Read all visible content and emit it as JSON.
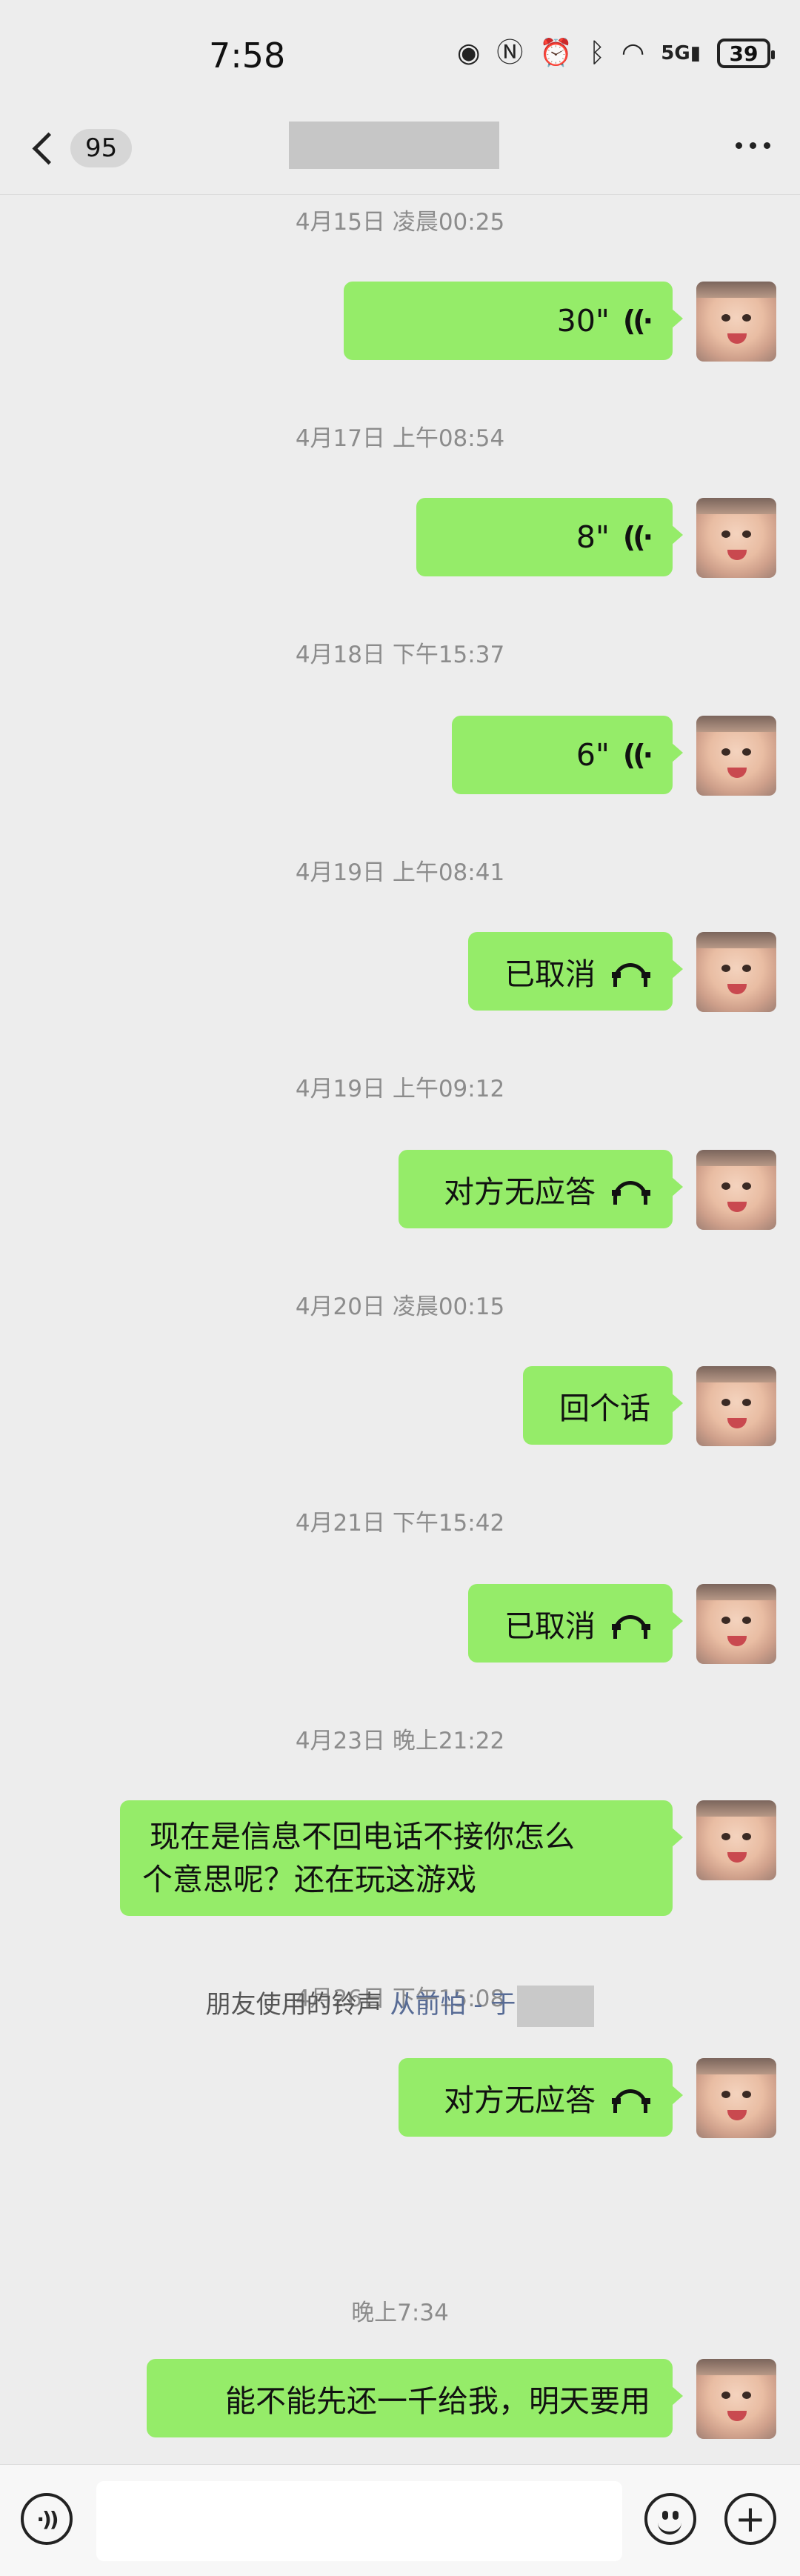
{
  "status_bar": {
    "time": "7:58",
    "icons": [
      "eye-icon",
      "nfc-icon",
      "alarm-icon",
      "bluetooth-icon",
      "wifi-icon",
      "signal-5g-icon"
    ],
    "network": "5G",
    "battery": "39"
  },
  "nav": {
    "unread_count": "95",
    "title": ""
  },
  "messages": [
    {
      "timestamp": "4月15日 凌晨00:25",
      "type": "voice",
      "text": "30\""
    },
    {
      "timestamp": "4月17日 上午08:54",
      "type": "voice",
      "text": "8\""
    },
    {
      "timestamp": "4月18日 下午15:37",
      "type": "voice",
      "text": "6\""
    },
    {
      "timestamp": "4月19日 上午08:41",
      "type": "call",
      "text": "已取消"
    },
    {
      "timestamp": "4月19日 上午09:12",
      "type": "call",
      "text": "对方无应答"
    },
    {
      "timestamp": "4月20日 凌晨00:15",
      "type": "text",
      "text": "回个话"
    },
    {
      "timestamp": "4月21日 下午15:42",
      "type": "call",
      "text": "已取消"
    },
    {
      "timestamp": "4月23日 晚上21:22",
      "type": "text",
      "lines": [
        "现在是信息不回电话不接你怎么",
        "个意思呢？还在玩这游戏"
      ]
    },
    {
      "timestamp": "4月26日 下午15:08",
      "type": "call",
      "text": "对方无应答"
    },
    {
      "timestamp": "晚上7:34",
      "type": "text",
      "text": "能不能先还一千给我，明天要用"
    }
  ],
  "ringtone": {
    "prefix": "朋友使用的铃声",
    "song": "从前怕 - 于"
  },
  "input": {
    "placeholder": ""
  },
  "colors": {
    "background": "#ededed",
    "bubble": "#95ec69",
    "link": "#576b95"
  }
}
